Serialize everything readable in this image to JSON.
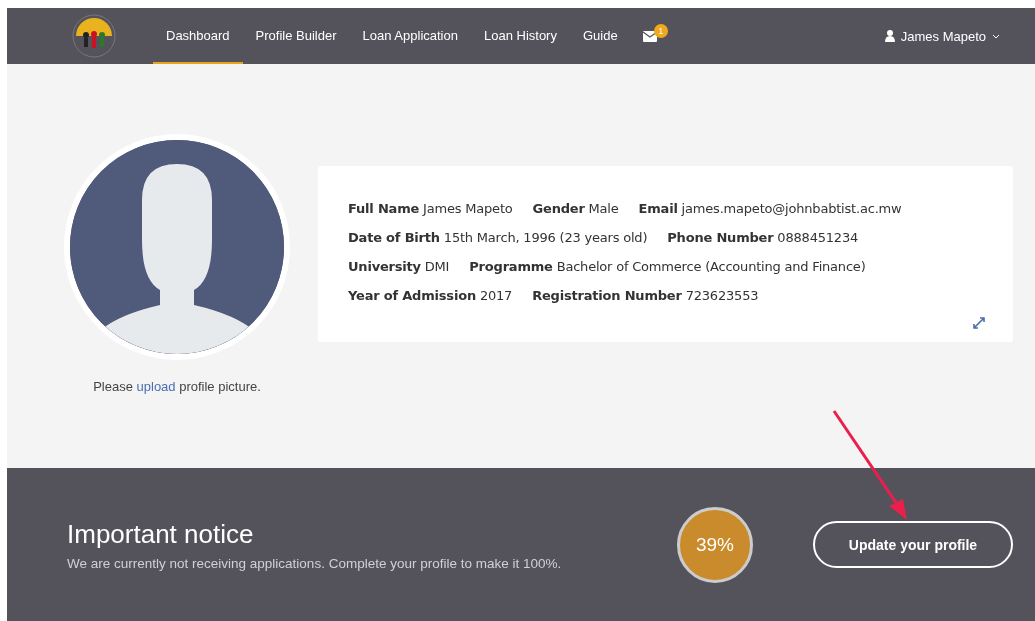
{
  "navbar": {
    "items": [
      {
        "label": "Dashboard",
        "selected": true
      },
      {
        "label": "Profile Builder",
        "selected": false
      },
      {
        "label": "Loan Application",
        "selected": false
      },
      {
        "label": "Loan History",
        "selected": false
      },
      {
        "label": "Guide",
        "selected": false
      }
    ],
    "messages_badge": "1",
    "user": "James Mapeto"
  },
  "profile": {
    "upload_prompt": {
      "before": "Please ",
      "link": "upload",
      "after": " profile picture."
    },
    "rows": [
      [
        {
          "label": "Full Name",
          "value": "James Mapeto"
        },
        {
          "label": "Gender",
          "value": "Male"
        },
        {
          "label": "Email",
          "value": "james.mapeto@johnbabtist.ac.mw"
        }
      ],
      [
        {
          "label": "Date of Birth",
          "value": "15th March, 1996 (23 years old)"
        },
        {
          "label": "Phone Number",
          "value": "0888451234"
        }
      ],
      [
        {
          "label": "University",
          "value": "DMI"
        },
        {
          "label": "Programme",
          "value": "Bachelor of Commerce (Accounting and Finance)"
        }
      ],
      [
        {
          "label": "Year of Admission",
          "value": "2017"
        },
        {
          "label": "Registration Number",
          "value": "723623553"
        }
      ]
    ]
  },
  "notice": {
    "title": "Important notice",
    "text": "We are currently not receiving applications. Complete your profile to make it 100%.",
    "completion": "39%",
    "button": "Update your profile"
  }
}
